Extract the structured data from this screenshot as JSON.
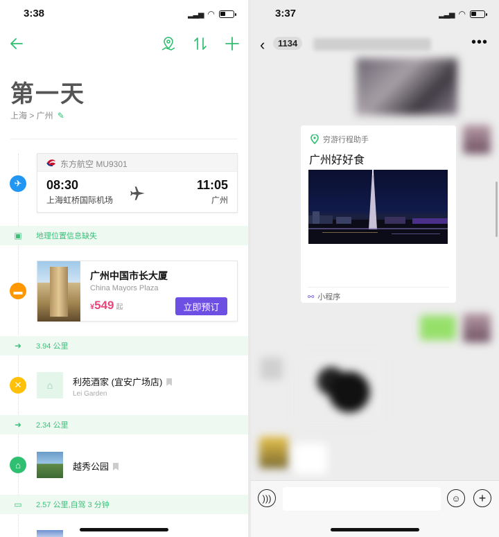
{
  "left": {
    "status": {
      "time": "3:38"
    },
    "toolbar": {
      "back_icon": "arrow-left-icon",
      "map_icon": "map-pin-icon",
      "sort_icon": "sort-icon",
      "add_icon": "plus-icon"
    },
    "day_title": "第一天",
    "route": "上海 > 广州",
    "flight": {
      "airline": "东方航空 MU9301",
      "dep_time": "08:30",
      "arr_time": "11:05",
      "dep_place": "上海虹桥国际机场",
      "arr_place": "广州"
    },
    "bands": {
      "location_missing": "地理位置信息缺失",
      "dist1": "3.94 公里",
      "dist2": "2.34 公里",
      "dist3": "2.57 公里,自驾 3 分钟"
    },
    "hotel": {
      "name": "广州中国市长大厦",
      "name_en": "China Mayors Plaza",
      "currency": "¥",
      "price": "549",
      "price_suffix": "起",
      "book_label": "立即预订"
    },
    "restaurant": {
      "name": "利苑酒家 (宜安广场店)",
      "name_en": "Lei Garden"
    },
    "park": {
      "name": "越秀公园"
    }
  },
  "right": {
    "status": {
      "time": "3:37"
    },
    "chat": {
      "unread": "1134"
    },
    "card": {
      "source": "穷游行程助手",
      "title": "广州好好食",
      "footer": "小程序"
    }
  },
  "colors": {
    "accent": "#2fbf71",
    "flight_dot": "#2196f3",
    "hotel_dot": "#ff9800",
    "food_dot": "#ffc107",
    "book": "#6d4fe4",
    "price": "#e8457a"
  }
}
